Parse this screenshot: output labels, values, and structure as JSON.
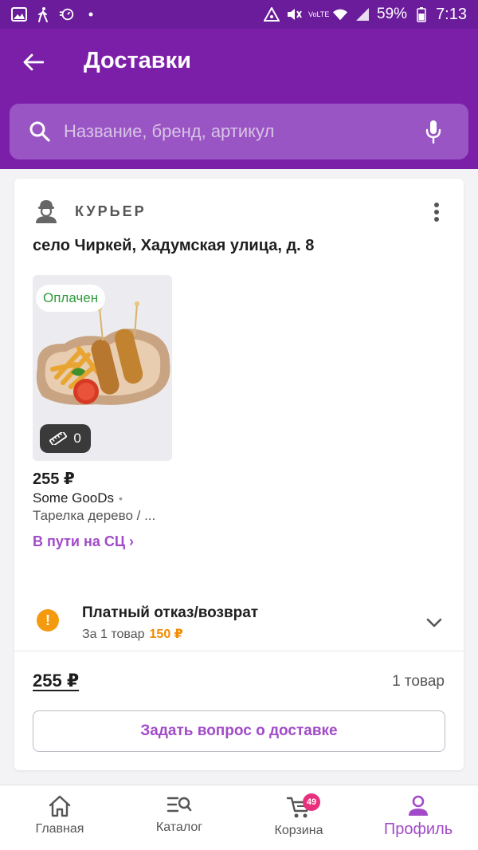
{
  "status_bar": {
    "battery": "59%",
    "time": "7:13",
    "volte": "VoLTE"
  },
  "header": {
    "title": "Доставки",
    "search": {
      "placeholder": "Название, бренд, артикул"
    }
  },
  "delivery": {
    "type_label": "КУРЬЕР",
    "address": "село Чиркей, Хадумская улица, д. 8",
    "item": {
      "payment_status": "Оплачен",
      "size_count": "0",
      "price": "255 ₽",
      "brand": "Some GooDs",
      "brand_dot": "•",
      "name": "Тарелка дерево / ...",
      "tracking_status": "В пути на СЦ ›"
    },
    "refund": {
      "title": "Платный отказ/возврат",
      "subtitle": "За 1 товар",
      "fee": "150 ₽"
    },
    "total": "255 ₽",
    "count": "1 товар",
    "ask_button": "Задать вопрос о доставке"
  },
  "nav": {
    "items": [
      {
        "label": "Главная",
        "icon": "home-icon"
      },
      {
        "label": "Каталог",
        "icon": "catalog-icon"
      },
      {
        "label": "Корзина",
        "icon": "cart-icon",
        "badge": "49"
      },
      {
        "label": "Профиль",
        "icon": "profile-icon",
        "active": true
      }
    ]
  },
  "colors": {
    "brand_purple": "#7b1fa9",
    "accent_purple": "#a24bc8",
    "warning_orange": "#f59a0f",
    "paid_green": "#2e9a3a",
    "badge_pink": "#e8317c"
  }
}
